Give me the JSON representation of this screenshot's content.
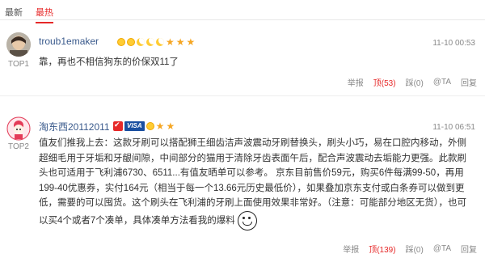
{
  "tabs": [
    {
      "label": "最新"
    },
    {
      "label": "最热"
    }
  ],
  "comments": [
    {
      "username": "troub1emaker",
      "top": "TOP1",
      "time": "11-10 00:53",
      "content": "靠，再也不相信狗东的价保双11了",
      "actions": {
        "report": "举报",
        "upvote": "顶(53)",
        "downvote": "踩(0)",
        "at": "@TA",
        "reply": "回复"
      }
    },
    {
      "username": "淘东西20112011",
      "top": "TOP2",
      "time": "11-10 06:51",
      "content": "值友们推我上去：这款牙刷可以搭配狮王细齿洁声波震动牙刷替换头，刷头小巧，易在口腔内移动，外侧超细毛用于牙垢和牙龈间隙，中间部分的猫用于清除牙齿表面午后，配合声波震动去垢能力更强。此款刷头也可适用于飞利浦6730、6511...有值友晒单可以参考。 京东目前售价59元，购买6件每满99-50，再用199-40优惠券，实付164元（相当于每一个13.66元历史最低价），如果叠加京东支付或白条券可以做到更低，需要的可以囤货。这个刷头在飞利浦的牙刷上面使用效果非常好。（注意：可能部分地区无货），也可以买4个或者7个凑单，具体凑单方法看我的爆料",
      "badge_visa": "VISA",
      "actions": {
        "report": "举报",
        "upvote": "顶(139)",
        "downvote": "踩(0)",
        "at": "@TA",
        "reply": "回复"
      }
    }
  ],
  "icons": {
    "level": [
      "sun-icon",
      "moon-icon",
      "star-icon"
    ],
    "emoji": "laughing-face-icon"
  },
  "colors": {
    "accent": "#e62828",
    "link": "#3a5a8c"
  }
}
